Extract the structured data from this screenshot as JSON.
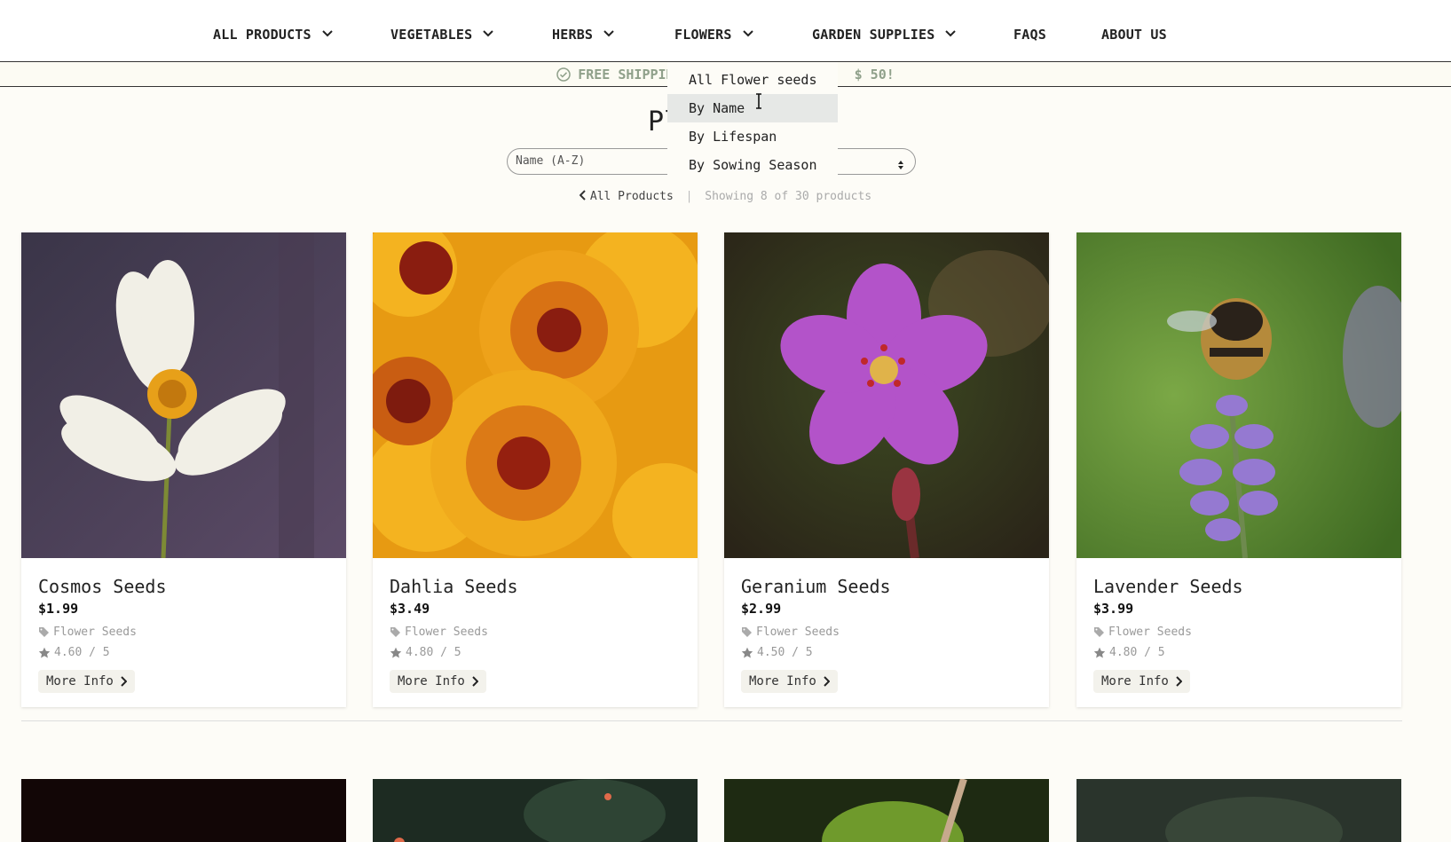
{
  "nav": {
    "items": [
      {
        "label": "ALL PRODUCTS",
        "dropdown": true
      },
      {
        "label": "VEGETABLES",
        "dropdown": true
      },
      {
        "label": "HERBS",
        "dropdown": true
      },
      {
        "label": "FLOWERS",
        "dropdown": true
      },
      {
        "label": "GARDEN SUPPLIES",
        "dropdown": true
      },
      {
        "label": "FAQS",
        "dropdown": false
      },
      {
        "label": "ABOUT US",
        "dropdown": false
      }
    ]
  },
  "banner": {
    "text_left": "FREE SHIPPING",
    "text_right": "$ 50!"
  },
  "flowers_menu": {
    "items": [
      "All Flower seeds",
      "By Name",
      "By Lifespan",
      "By Sowing Season"
    ],
    "hovered": "By Name"
  },
  "page": {
    "title_visible": "Pl"
  },
  "sort": {
    "value": "Name (A-Z)"
  },
  "breadcrumb": {
    "back": "All Products",
    "count": "Showing 8 of 30 products"
  },
  "products": [
    {
      "name": "Cosmos Seeds",
      "price": "$1.99",
      "category": "Flower Seeds",
      "rating": "4.60 / 5",
      "button": "More Info"
    },
    {
      "name": "Dahlia Seeds",
      "price": "$3.49",
      "category": "Flower Seeds",
      "rating": "4.80 / 5",
      "button": "More Info"
    },
    {
      "name": "Geranium Seeds",
      "price": "$2.99",
      "category": "Flower Seeds",
      "rating": "4.50 / 5",
      "button": "More Info"
    },
    {
      "name": "Lavender Seeds",
      "price": "$3.99",
      "category": "Flower Seeds",
      "rating": "4.80 / 5",
      "button": "More Info"
    }
  ],
  "colors": {
    "banner_text": "#8fa08a",
    "page_bg": "#fdfcf7",
    "hover_bg": "#e6e8e6"
  }
}
